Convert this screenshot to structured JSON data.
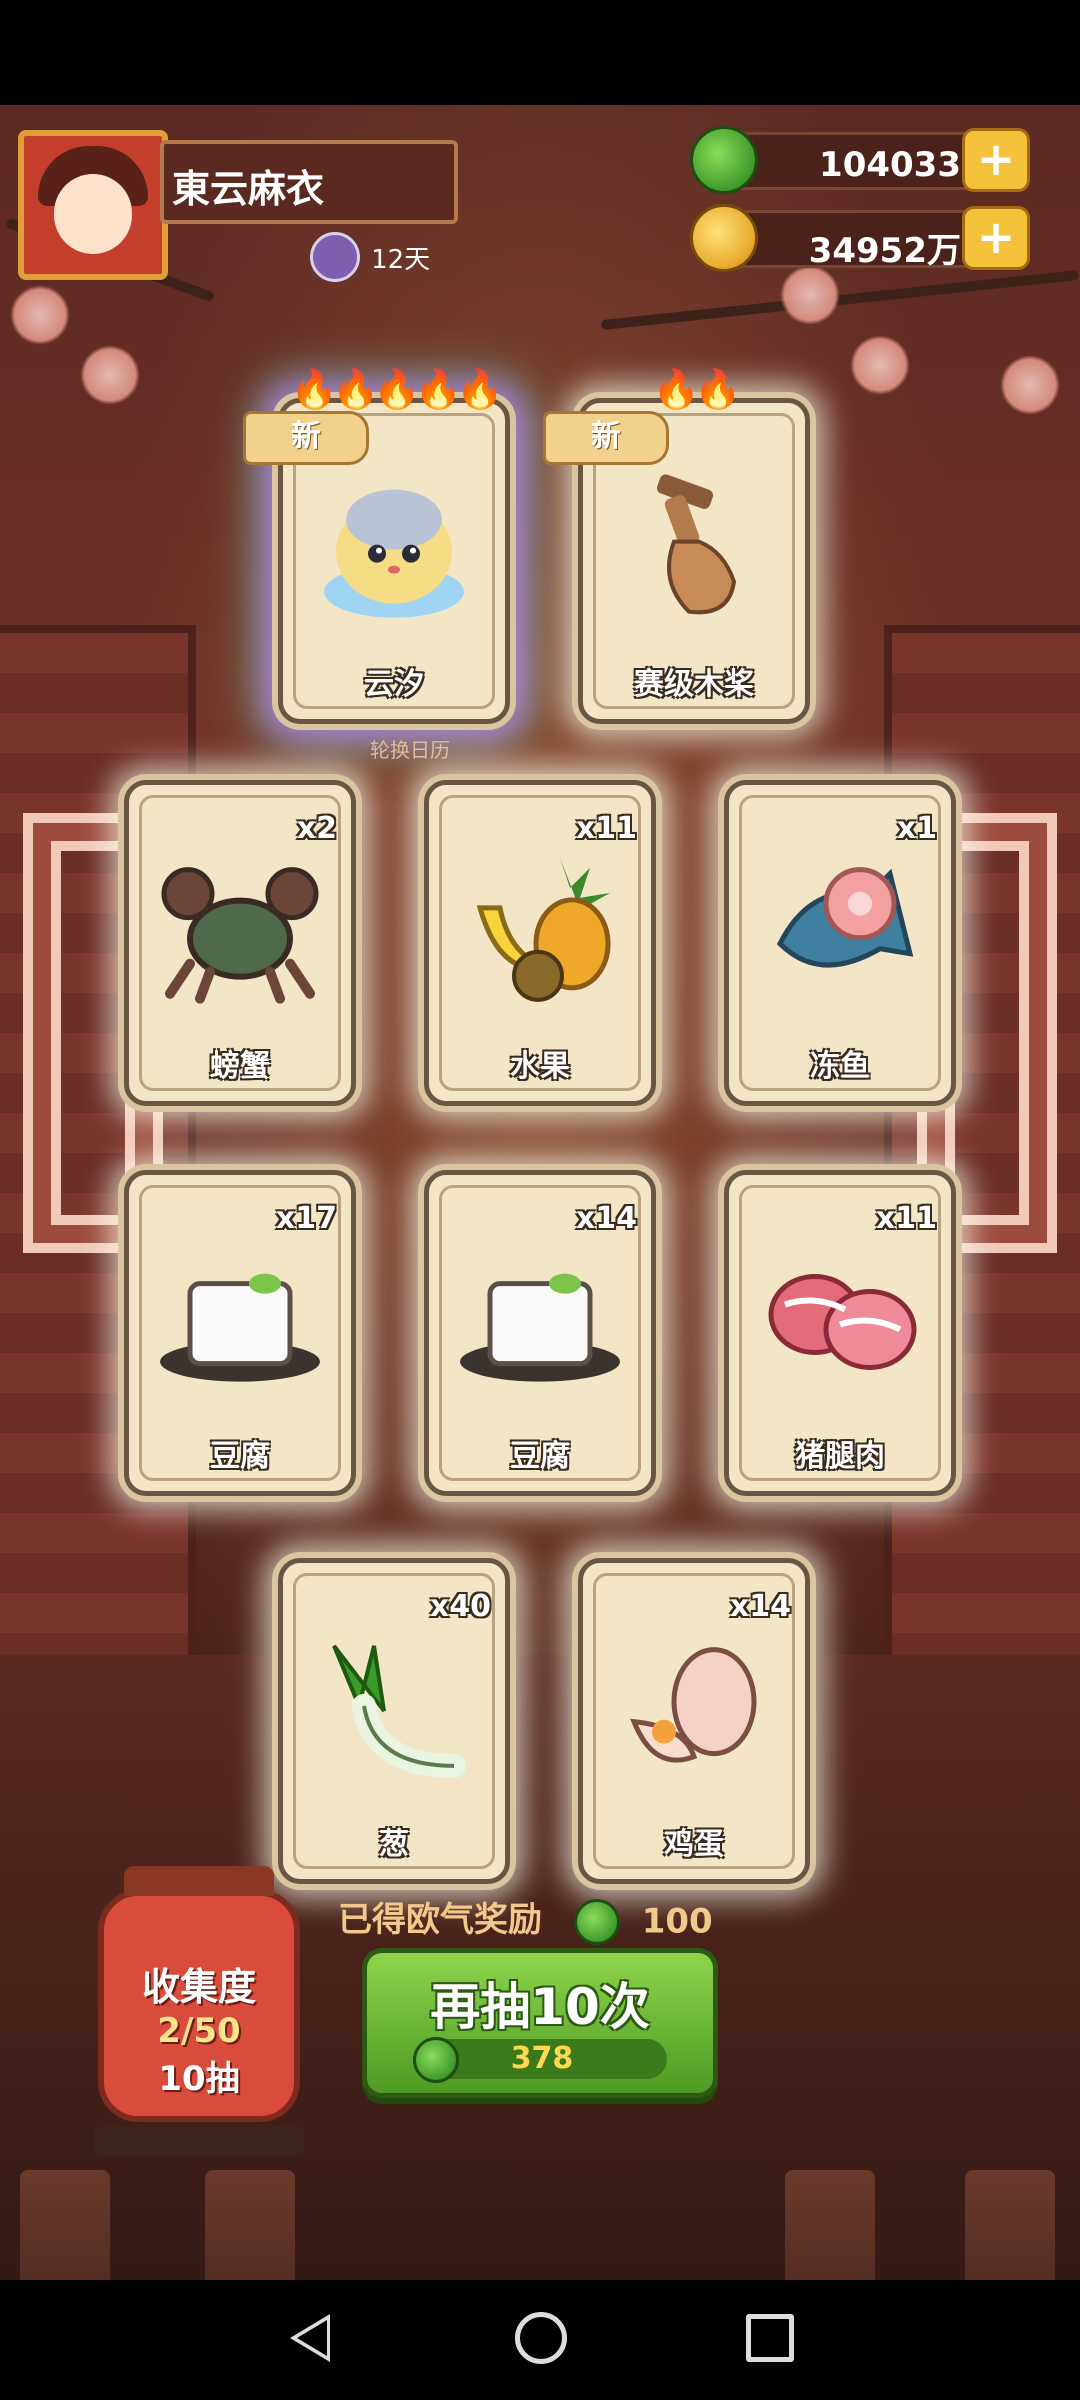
{
  "player": {
    "name": "東云麻衣",
    "days": "12天"
  },
  "currency": {
    "jade": "104033",
    "gold": "34952万"
  },
  "rotation_label": "轮换日历",
  "featured": [
    {
      "label": "云汐",
      "badge": "新",
      "stars": "🔥🔥🔥🔥🔥"
    },
    {
      "label": "赛级木桨",
      "badge": "新",
      "stars": "🔥🔥"
    }
  ],
  "items": [
    {
      "label": "螃蟹",
      "count": "x2"
    },
    {
      "label": "水果",
      "count": "x11"
    },
    {
      "label": "冻鱼",
      "count": "x1"
    },
    {
      "label": "豆腐",
      "count": "x17"
    },
    {
      "label": "豆腐",
      "count": "x14"
    },
    {
      "label": "猪腿肉",
      "count": "x11"
    },
    {
      "label": "葱",
      "count": "x40"
    },
    {
      "label": "鸡蛋",
      "count": "x14"
    }
  ],
  "collection": {
    "title": "收集度",
    "progress": "2/50",
    "pulls": "10抽"
  },
  "reward": {
    "text": "已得欧气奖励",
    "value": "100"
  },
  "draw_button": {
    "label": "再抽10次",
    "cost": "378"
  },
  "colors": {
    "accent_green": "#5aa82a",
    "gold": "#f5c33b",
    "lantern_red": "#d94b3a"
  }
}
